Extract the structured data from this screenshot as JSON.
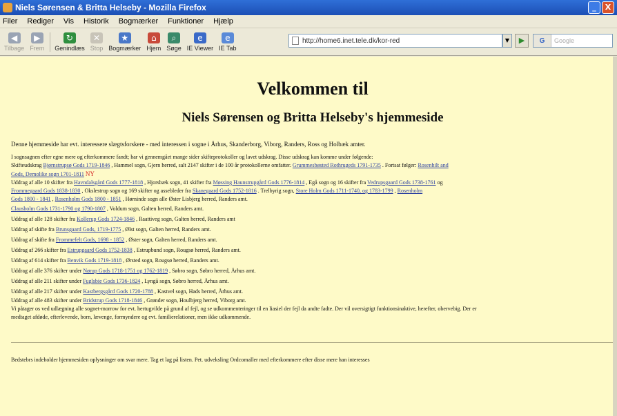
{
  "window": {
    "title": "Niels Sørensen & Britta Helseby - Mozilla Firefox",
    "minimize": "_",
    "close": "X"
  },
  "menu": [
    "Filer",
    "Rediger",
    "Vis",
    "Historik",
    "Bogmærker",
    "Funktioner",
    "Hjælp"
  ],
  "toolbar": {
    "buttons": [
      {
        "label": "Tilbage",
        "icon": "back-arrow-icon",
        "color": "#9aa4b4",
        "disabled": true
      },
      {
        "label": "Frem",
        "icon": "forward-arrow-icon",
        "color": "#9aa4b4",
        "disabled": true
      },
      {
        "label": "Genindlæs",
        "icon": "reload-icon",
        "color": "#2f8f3f",
        "disabled": false
      },
      {
        "label": "Stop",
        "icon": "stop-icon",
        "color": "#c8c4b8",
        "disabled": true
      },
      {
        "label": "Bogmærker",
        "icon": "bookmarks-icon",
        "color": "#4a78c8",
        "disabled": false
      },
      {
        "label": "Hjem",
        "icon": "home-icon",
        "color": "#c84a3a",
        "disabled": false
      },
      {
        "label": "Søge",
        "icon": "search-icon",
        "color": "#3a8a6a",
        "disabled": false
      },
      {
        "label": "IE Viewer",
        "icon": "ie-viewer-icon",
        "color": "#3a6ac8",
        "disabled": false
      },
      {
        "label": "IE Tab",
        "icon": "ie-tab-icon",
        "color": "#5a8ad8",
        "disabled": false
      }
    ],
    "url": "http://home6.inet.tele.dk/kor-red",
    "search_placeholder": "Google",
    "search_engine": "G"
  },
  "page": {
    "title": "Velkommen til",
    "subtitle": "Niels Sørensen og Britta Helseby's hjemmeside",
    "intro": "Denne hjemmeside har evt. interessere slægtsforskere - med interessen i sogne i Århus, Skanderborg, Viborg, Randers, Ross og Holbæk amter.",
    "para_line1": "I sognsagnen efter egne mere og efterkommere fandt; har vi gennemgået mange sider skifteprotokoller og lavet udskrag. Disse udskrag kan komme under følgende:",
    "para_line2_text": "Skifteudskrag",
    "para_line2_link1": "Bjørnstrupsø Gods 1719-1846",
    "para_line2_mid": ", Hammel sogn, Gjern herred, salt 2147 skifter i de 100 år protokollerne omfatter.",
    "para_line2_link2": "Grummesbøsted Rothrugeds 1791-1735",
    "para_line2_end": ". Fortsat følger:",
    "para_line2_link3": "Rosenhilt and",
    "para_line3_link": "Gods, Demolike sogn 1701-1811",
    "ny_label": "NY",
    "para_line4_a": "Uddrag af alle 10 skifter fra",
    "para_line4_link1": "Havndalsgård Gods 1777-1818",
    "para_line4_b": ", Hjorsbæk sogn, 41 skifter fra",
    "para_line4_link2": "Møssing Haunstrupgård Gods 1776-1814",
    "para_line4_c": ", Egå sogn og 16 skifter fra",
    "para_line4_link3": "Vedrupsgaard Gods 1738-1761",
    "para_line4_d": " og",
    "para_line5_link1": "Frommegaard Gods 1838-1830",
    "para_line5_a": ", Okslestrup sogn og 169 skifter og assebleder fra",
    "para_line5_link2": "Skanegaard Gods 1752-1816",
    "para_line5_b": ". Trelbyrig sogn,",
    "para_line5_link3": "Store Holm Gods 1711-1740, og 1783-1799",
    "para_line5_c": ",",
    "para_line5_link4": "Rosenholm",
    "para_line6_link1": "Gods 1800 - 1841",
    "para_line6_a": ",",
    "para_line6_link2": "Rosenholm Gods 1800 - 1851",
    "para_line6_b": ", Hørninde sogn alle Øster Lisbjerg herred, Randers amt.",
    "para_line7_link": "Clausholm Gods 1731-1790 og 1790-1807",
    "para_line7_text": ", Voldum sogn, Galten herred, Randers amt.",
    "lines": [
      {
        "pre": "Uddrag af alle 128 skifter fra",
        "link": "Kollerup Gods 1724-1846",
        "post": ", Raattiveg sogn, Galten herred, Randers amt"
      },
      {
        "pre": "Uddrag af skifte fra",
        "link": "Brunsgaard Gods, 1719-1775",
        "post": ", Ølst sogn, Galten herred, Randers amt."
      },
      {
        "pre": "Uddrag af skifte fra",
        "link": "Frommefelt Gods, 1698 - 1852",
        "post": ", Øster sogn, Galten herred, Randers amt."
      },
      {
        "pre": "Uddrag af 266 skifter fra",
        "link": "Estrupgaard Gods 1752-1838",
        "post": ", Estrupbund sogn, Rougsø herred, Randers amt."
      },
      {
        "pre": "Uddrag af 614 skifter fra",
        "link": "Benvik Gods 1719-1818",
        "post": ", Ørsted sogn, Rougsø herred, Randers amt."
      },
      {
        "pre": "Uddrag af alle 376 skifter under",
        "link": "Nørup Gods 1718-1751 og 1762-1819",
        "post": ", Søbro sogn, Søbro herred, Århus amt."
      },
      {
        "pre": "Uddrag af alle 211 skifter under",
        "link": "Fuglsbie Gods 1736-1824",
        "post": ", Lyngå sogn, Søbro herred, Århus amt."
      },
      {
        "pre": "Uddrag af alle 217 skifter under",
        "link": "Kastbergsgård Gods 1720-1788",
        "post": ", Kastvel sogn, Hads herred, Århus amt."
      },
      {
        "pre": "Uddrag af alle 483 skifter under",
        "link": "Bridstrup Gods 1718-1846",
        "post": ", Grønder sogn, Houlbjerg herred, Viborg amt."
      }
    ],
    "closing_line1": "Vi påtager os ved udlægning alle sognet-morrow for evt. hertugvilde på grund af fejl, og se udkommenteringer til en liasiel der fejl da andte fadte. Der vil oversigtigt funktionsinaktive, herefter, obervebig. Der er",
    "closing_line2": "medtaget afdøde, efterlevende, born, lævenge, formyndere og evt. familierelationer, men ikke udkommende.",
    "footer": "Bedstebrs indeholder hjemmesiden oplysninger om svar mere. Tag et lag på listen. Pet. udveksling Ordcomaller med efterkommere efter disse mere han interesses"
  }
}
